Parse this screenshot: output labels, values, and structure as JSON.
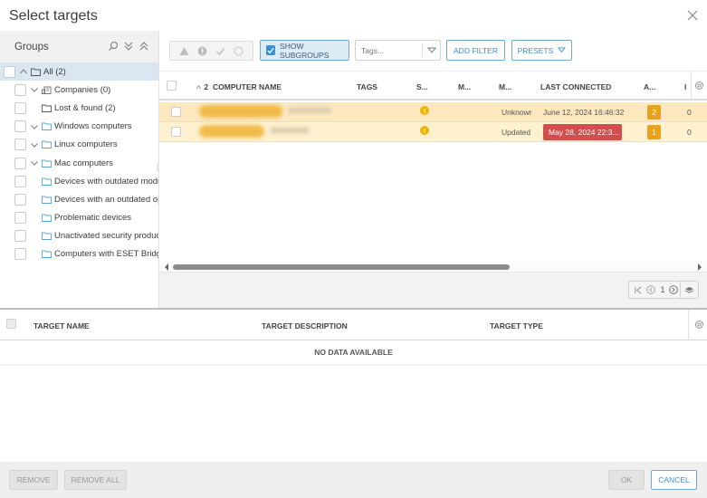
{
  "dialog": {
    "title": "Select targets"
  },
  "groups": {
    "header": "Groups",
    "items": [
      {
        "label": "All (2)",
        "level": 0,
        "expander": "up",
        "folder": "folder",
        "selected": true
      },
      {
        "label": "Companies (0)",
        "level": 1,
        "expander": "down",
        "folder": "company"
      },
      {
        "label": "Lost & found (2)",
        "level": 1,
        "expander": "none",
        "folder": "folder"
      },
      {
        "label": "Windows computers",
        "level": 1,
        "expander": "down",
        "folder": "dynamic"
      },
      {
        "label": "Linux computers",
        "level": 1,
        "expander": "down",
        "folder": "dynamic"
      },
      {
        "label": "Mac computers",
        "level": 1,
        "expander": "down",
        "folder": "dynamic"
      },
      {
        "label": "Devices with outdated modules",
        "level": 1,
        "expander": "none",
        "folder": "dynamic"
      },
      {
        "label": "Devices with an outdated operat",
        "level": 1,
        "expander": "none",
        "folder": "dynamic"
      },
      {
        "label": "Problematic devices",
        "level": 1,
        "expander": "none",
        "folder": "dynamic"
      },
      {
        "label": "Unactivated security product",
        "level": 1,
        "expander": "none",
        "folder": "dynamic"
      },
      {
        "label": "Computers with ESET Bridge inst",
        "level": 1,
        "expander": "none",
        "folder": "dynamic"
      }
    ]
  },
  "toolbar": {
    "show_subgroups": "SHOW SUBGROUPS",
    "show_subgroups_checked": true,
    "tags_placeholder": "Tags...",
    "add_filter": "ADD FILTER",
    "presets": "PRESETS"
  },
  "computers": {
    "sort_indicator": "2",
    "columns": [
      "COMPUTER NAME",
      "TAGS",
      "S...",
      "M...",
      "M...",
      "LAST CONNECTED",
      "A...",
      "I"
    ],
    "rows": [
      {
        "name": "[redacted]",
        "status": "warning",
        "modules": "Unknowr",
        "last_connected": "June 12, 2024 16:46:32",
        "last_connected_alert": false,
        "alerts": "2",
        "detections": "0",
        "color": "#fce7bf"
      },
      {
        "name": "[redacted]",
        "status": "warning",
        "modules": "Updated",
        "last_connected": "May 28, 2024 22:3...",
        "last_connected_alert": true,
        "alerts": "1",
        "detections": "0",
        "color": "#fdf1cf"
      }
    ],
    "pager": {
      "page": "1"
    }
  },
  "targets": {
    "columns": [
      "TARGET NAME",
      "TARGET DESCRIPTION",
      "TARGET TYPE"
    ],
    "empty_text": "NO DATA AVAILABLE"
  },
  "footer": {
    "remove": "REMOVE",
    "remove_all": "REMOVE ALL",
    "ok": "OK",
    "cancel": "CANCEL"
  },
  "colors": {
    "accent": "#3a8fd0",
    "warning": "#f0b400",
    "alert_badge": "#e8a21c",
    "danger": "#d14e4e"
  }
}
